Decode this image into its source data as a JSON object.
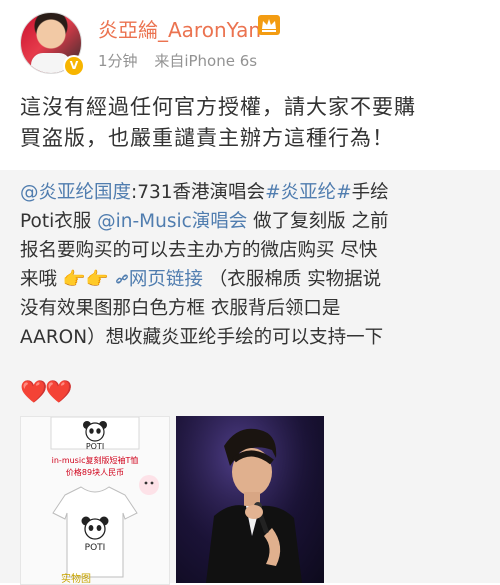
{
  "post": {
    "username": "炎亞綸_AaronYan",
    "time": "1分钟",
    "source": "来自iPhone 6s",
    "text_lines": [
      "這沒有經過任何官方授權，請大家不要購",
      "買盗版，也嚴重譴責主辦方這種行為！"
    ]
  },
  "repost": {
    "mention_user": "@炎亚纶国度",
    "seg_after_mention": ":731香港演唱会",
    "hashtag": "#炎亚纶#",
    "seg_after_hashtag": "手绘",
    "seg_line2_start": "Poti衣服 ",
    "mention_music": "@in-Music演唱会",
    "seg_after_music": " 做了复刻版 之前",
    "line3": "报名要购买的可以去主办方的微店购买 尽快",
    "seg_line4_start": "来哦 ",
    "hand_emoji": "👉👉",
    "link_label": "网页链接",
    "seg_after_link": "（衣服棉质 实物据说",
    "line5": "没有效果图那白色方框 衣服背后领口是",
    "line6": "AARON）想收藏炎亚纶手绘的可以支持一下",
    "hearts": "❤️❤️"
  },
  "images": {
    "tshirt_caption_1": "POTI",
    "tshirt_caption_2": "POTI",
    "promo_text_1": "in-music复刻版短袖T恤",
    "promo_text_2": "价格89块人民币",
    "footer_text": "实物图"
  },
  "colors": {
    "username": "#eb7350",
    "link": "#507daf",
    "repost_bg": "#f4f4f4",
    "verified_badge": "#f7b500"
  },
  "icons": [
    "crown-icon",
    "verified-badge-icon",
    "hand-pointing-icon",
    "link-icon",
    "heart-icon"
  ]
}
